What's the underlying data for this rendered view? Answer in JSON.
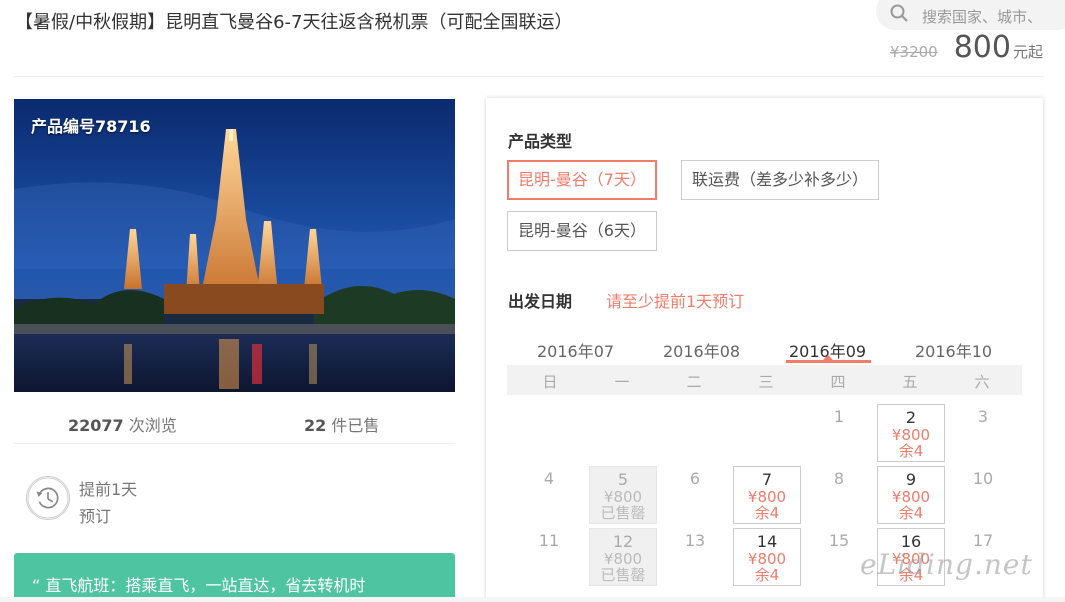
{
  "title": "【暑假/中秋假期】昆明直飞曼谷6-7天往返含税机票（可配全国联运）",
  "search": {
    "placeholder": "搜索国家、城市、"
  },
  "price": {
    "old": "¥3200",
    "current": "800",
    "unit": "元起"
  },
  "photo": {
    "product_no": "产品编号78716"
  },
  "stats": {
    "views_count": "22077",
    "views_label": "次浏览",
    "sold_count": "22",
    "sold_label": "件已售"
  },
  "advance": {
    "line1": "提前1天",
    "line2": "预订"
  },
  "promo": {
    "text": "“ 直飞航班：搭乘直飞，一站直达，省去转机时"
  },
  "panel": {
    "type_label": "产品类型",
    "types": [
      "昆明-曼谷（7天）",
      "联运费（差多少补多少）",
      "昆明-曼谷（6天）"
    ],
    "active_type": 0,
    "date_label": "出发日期",
    "date_note": "请至少提前1天预订",
    "months": [
      "2016年07",
      "2016年08",
      "2016年09",
      "2016年10"
    ],
    "active_month": 2,
    "weekdays": [
      "日",
      "一",
      "二",
      "三",
      "四",
      "五",
      "六"
    ],
    "calendar": [
      [
        null,
        null,
        null,
        null,
        {
          "d": "1"
        },
        {
          "d": "2",
          "p": "¥800",
          "r": "余4"
        },
        {
          "d": "3"
        }
      ],
      [
        {
          "d": "4"
        },
        {
          "d": "5",
          "p": "¥800",
          "r": "已售罄",
          "sold": true
        },
        {
          "d": "6"
        },
        {
          "d": "7",
          "p": "¥800",
          "r": "余4"
        },
        {
          "d": "8"
        },
        {
          "d": "9",
          "p": "¥800",
          "r": "余4"
        },
        {
          "d": "10"
        }
      ],
      [
        {
          "d": "11"
        },
        {
          "d": "12",
          "p": "¥800",
          "r": "已售罄",
          "sold": true
        },
        {
          "d": "13"
        },
        {
          "d": "14",
          "p": "¥800",
          "r": "余4"
        },
        {
          "d": "15"
        },
        {
          "d": "16",
          "p": "¥800",
          "r": "余4"
        },
        {
          "d": "17"
        }
      ]
    ]
  },
  "watermark": "eLiding.net",
  "colors": {
    "accent": "#f07c6a",
    "promo": "#4fc4a1"
  }
}
